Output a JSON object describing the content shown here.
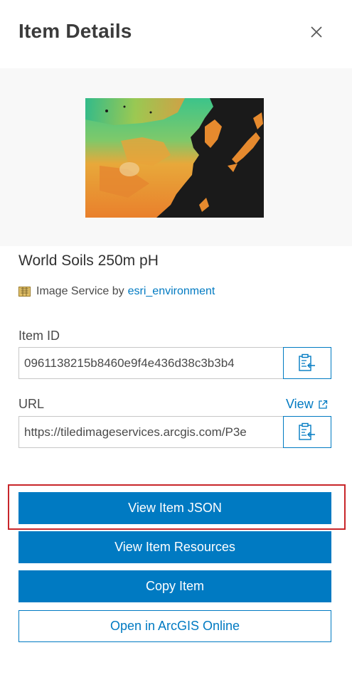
{
  "panel": {
    "title": "Item Details",
    "close_icon": "close-icon"
  },
  "item": {
    "name": "World Soils 250m pH",
    "type_icon": "image-service-icon",
    "type_label": "Image Service by",
    "owner": "esri_environment"
  },
  "fields": {
    "item_id_label": "Item ID",
    "item_id_value": "0961138215b8460e9f4e436d38c3b3b4",
    "url_label": "URL",
    "url_value": "https://tiledimageservices.arcgis.com/P3e",
    "view_link_label": "View",
    "copy_icon": "clipboard-copy-icon",
    "external_icon": "external-link-icon"
  },
  "actions": {
    "view_json": "View Item JSON",
    "view_resources": "View Item Resources",
    "copy_item": "Copy Item",
    "open_online": "Open in ArcGIS Online"
  },
  "colors": {
    "brand_blue": "#007ac2",
    "highlight_red": "#c8262a",
    "thumb_bg": "#f8f8f8"
  }
}
